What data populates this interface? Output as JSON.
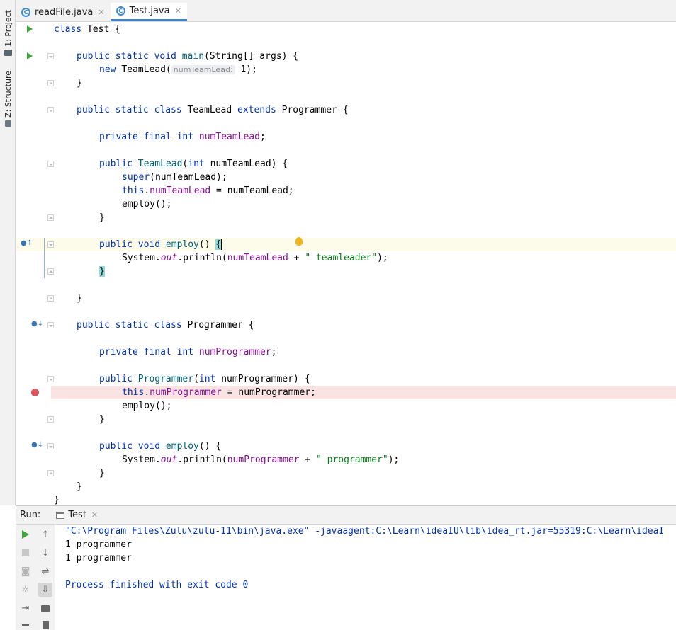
{
  "tool_strip": {
    "project_label": "1: Project",
    "structure_label": "Z: Structure"
  },
  "tabs": [
    {
      "label": "readFile.java",
      "icon": "java-class-icon",
      "active": false
    },
    {
      "label": "Test.java",
      "icon": "java-class-icon",
      "active": true
    }
  ],
  "editor": {
    "lines": {
      "l1": {
        "a": "class",
        "b": " Test {"
      },
      "l3": {
        "a": "public static void ",
        "b": "main",
        "c": "(String[] args) {"
      },
      "l4": {
        "a": "new ",
        "b": "TeamLead(",
        "hint": "numTeamLead:",
        "c": " 1);"
      },
      "l5": "}",
      "l7": {
        "a": "public static class ",
        "b": "TeamLead ",
        "c": "extends ",
        "d": "Programmer {"
      },
      "l9": {
        "a": "private final int ",
        "b": "numTeamLead",
        "c": ";"
      },
      "l11": {
        "a": "public ",
        "b": "TeamLead",
        "c": "(",
        "d": "int ",
        "e": "numTeamLead) {"
      },
      "l12": {
        "a": "super",
        "b": "(numTeamLead);"
      },
      "l13": {
        "a": "this",
        "b": ".",
        "c": "numTeamLead",
        "d": " = numTeamLead;"
      },
      "l14": "employ();",
      "l15": "}",
      "l17": {
        "a": "public void ",
        "b": "employ",
        "c": "() ",
        "d": "{"
      },
      "l18": {
        "a": "System.",
        "b": "out",
        "c": ".println(",
        "d": "numTeamLead",
        "e": " + ",
        "f": "\" teamleader\"",
        "g": ");"
      },
      "l19": "}",
      "l21": "}",
      "l23": {
        "a": "public static class ",
        "b": "Programmer {"
      },
      "l25": {
        "a": "private final int ",
        "b": "numProgrammer",
        "c": ";"
      },
      "l27": {
        "a": "public ",
        "b": "Programmer",
        "c": "(",
        "d": "int ",
        "e": "numProgrammer) {"
      },
      "l28": {
        "a": "this",
        "b": ".",
        "c": "numProgrammer",
        "d": " = numProgrammer;"
      },
      "l29": "employ();",
      "l30": "}",
      "l32": {
        "a": "public void ",
        "b": "employ",
        "c": "() {"
      },
      "l33": {
        "a": "System.",
        "b": "out",
        "c": ".println(",
        "d": "numProgrammer",
        "e": " + ",
        "f": "\" programmer\"",
        "g": ");"
      },
      "l34": "}",
      "l35": "}",
      "l36": "}"
    }
  },
  "run_panel": {
    "title": "Run:",
    "tab_label": "Test",
    "console": {
      "cmd": "\"C:\\Program Files\\Zulu\\zulu-11\\bin\\java.exe\" -javaagent:C:\\Learn\\ideaIU\\lib\\idea_rt.jar=55319:C:\\Learn\\ideaI",
      "out1": "1 programmer",
      "out2": "1 programmer",
      "exit": "Process finished with exit code 0"
    }
  },
  "colors": {
    "keyword": "#0033b3",
    "field": "#871094",
    "method": "#00627a",
    "string": "#067d17",
    "breakpoint_line": "#fae3e3",
    "caret_line": "#fdfbea"
  }
}
